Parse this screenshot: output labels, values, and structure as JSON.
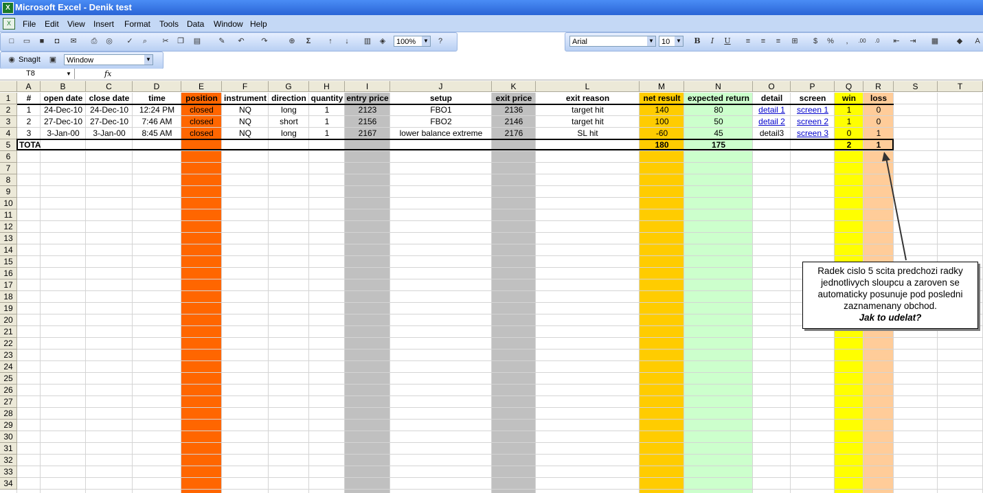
{
  "window": {
    "title": "Microsoft Excel - Denik test"
  },
  "menu": [
    "File",
    "Edit",
    "View",
    "Insert",
    "Format",
    "Tools",
    "Data",
    "Window",
    "Help"
  ],
  "toolbar": {
    "zoom": "100%",
    "font": "Arial",
    "font_size": "10"
  },
  "snagit": {
    "label": "SnagIt",
    "combo": "Window"
  },
  "formula_bar": {
    "name_box": "T8",
    "fx": "fx"
  },
  "columns": [
    "A",
    "B",
    "C",
    "D",
    "E",
    "F",
    "G",
    "H",
    "I",
    "J",
    "K",
    "L",
    "M",
    "N",
    "O",
    "P",
    "Q",
    "R",
    "S",
    "T"
  ],
  "row_numbers": [
    "1",
    "2",
    "3",
    "4",
    "5",
    "6",
    "7",
    "8",
    "9",
    "10",
    "11",
    "12",
    "13",
    "14",
    "15",
    "16",
    "17",
    "18",
    "19",
    "20",
    "21",
    "22",
    "23",
    "24",
    "25",
    "26",
    "27",
    "28",
    "29",
    "30",
    "31",
    "32",
    "33",
    "34"
  ],
  "header_row": [
    "#",
    "open date",
    "close date",
    "time",
    "position",
    "instrument",
    "direction",
    "quantity",
    "entry price",
    "setup",
    "exit price",
    "exit reason",
    "net result",
    "expected return",
    "detail",
    "screen",
    "win",
    "loss"
  ],
  "rows": [
    [
      "1",
      "24-Dec-10",
      "24-Dec-10",
      "12:24 PM",
      "closed",
      "NQ",
      "long",
      "1",
      "2123",
      "FBO1",
      "2136",
      "target hit",
      "140",
      "80",
      "detail 1",
      "screen 1",
      "1",
      "0"
    ],
    [
      "2",
      "27-Dec-10",
      "27-Dec-10",
      "7:46 AM",
      "closed",
      "NQ",
      "short",
      "1",
      "2156",
      "FBO2",
      "2146",
      "target hit",
      "100",
      "50",
      "detail 2",
      "screen 2",
      "1",
      "0"
    ],
    [
      "3",
      "3-Jan-00",
      "3-Jan-00",
      "8:45 AM",
      "closed",
      "NQ",
      "long",
      "1",
      "2167",
      "lower balance extreme",
      "2176",
      "SL hit",
      "-60",
      "45",
      "detail3",
      "screen 3",
      "0",
      "1"
    ]
  ],
  "total_row": {
    "label": "TOTAL",
    "net_result": "180",
    "expected_return": "175",
    "win": "2",
    "loss": "1"
  },
  "callout": {
    "lines": [
      "Radek cislo 5 scita predchozi radky",
      "jednotlivych sloupcu  a zaroven se",
      "automaticky posunuje pod posledni",
      "zaznamenany obchod."
    ],
    "question": "Jak to udelat?"
  },
  "colors": {
    "position": "#ff6600",
    "entry_exit": "#c0c0c0",
    "net_result": "#ffcc00",
    "expected_return": "#ccffcc",
    "win": "#ffff00",
    "loss": "#ffcc99"
  }
}
